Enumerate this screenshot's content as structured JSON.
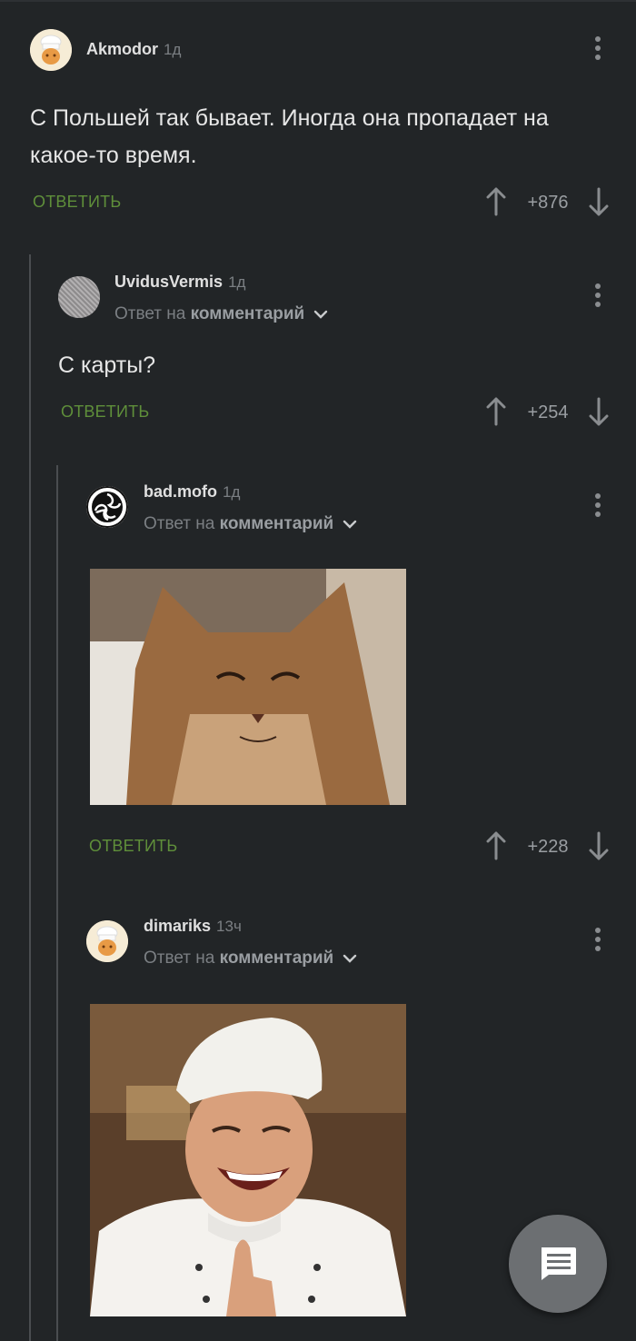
{
  "comments": [
    {
      "username": "Akmodor",
      "time": "1д",
      "text": "С Польшей так бывает. Иногда она пропадает на какое-то время.",
      "reply_label": "ОТВЕТИТЬ",
      "score": "+876"
    },
    {
      "username": "UvidusVermis",
      "time": "1д",
      "reply_prefix": "Ответ на",
      "reply_target": "комментарий",
      "text": "С карты?",
      "reply_label": "ОТВЕТИТЬ",
      "score": "+254"
    },
    {
      "username": "bad.mofo",
      "time": "1д",
      "reply_prefix": "Ответ на",
      "reply_target": "комментарий",
      "image": "smug-cat-photo",
      "reply_label": "ОТВЕТИТЬ",
      "score": "+228"
    },
    {
      "username": "dimariks",
      "time": "13ч",
      "reply_prefix": "Ответ на",
      "reply_target": "комментарий",
      "image": "laughing-chef-photo"
    }
  ],
  "colors": {
    "background": "#222527",
    "reply_green": "#5f8f3a",
    "muted": "#7b7f83"
  },
  "fab": {
    "icon": "comment-icon"
  }
}
